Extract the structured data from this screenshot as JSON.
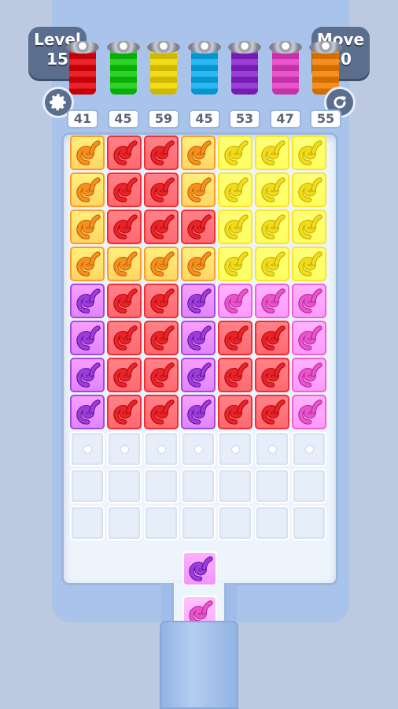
{
  "hud": {
    "level_label": "Level",
    "level_value": "15",
    "move_label": "Move",
    "move_value": "30"
  },
  "buttons": {
    "settings_icon": "gear-icon",
    "restart_icon": "restart-icon"
  },
  "colors": {
    "orange": "#f5901e",
    "red": "#e8232a",
    "yellow": "#f2dc1a",
    "purple": "#9a3fd6",
    "pink": "#e854c9",
    "green": "#2ed12a",
    "blue": "#2bb7f0"
  },
  "spools": [
    {
      "color": "red",
      "count": "41"
    },
    {
      "color": "green",
      "count": "45"
    },
    {
      "color": "yellow",
      "count": "59"
    },
    {
      "color": "blue",
      "count": "45"
    },
    {
      "color": "purple",
      "count": "53"
    },
    {
      "color": "pink",
      "count": "47"
    },
    {
      "color": "orange",
      "count": "55"
    }
  ],
  "grid": [
    [
      "orange",
      "red",
      "red",
      "orange",
      "yellow",
      "yellow",
      "yellow"
    ],
    [
      "orange",
      "red",
      "red",
      "orange",
      "yellow",
      "yellow",
      "yellow"
    ],
    [
      "orange",
      "red",
      "red",
      "red",
      "yellow",
      "yellow",
      "yellow"
    ],
    [
      "orange",
      "orange",
      "orange",
      "orange",
      "yellow",
      "yellow",
      "yellow"
    ],
    [
      "purple",
      "red",
      "red",
      "purple",
      "pink",
      "pink",
      "pink"
    ],
    [
      "purple",
      "red",
      "red",
      "purple",
      "red",
      "red",
      "pink"
    ],
    [
      "purple",
      "red",
      "red",
      "purple",
      "red",
      "red",
      "pink"
    ],
    [
      "purple",
      "red",
      "red",
      "purple",
      "red",
      "red",
      "pink"
    ],
    [
      "dot",
      "dot",
      "dot",
      "dot",
      "dot",
      "dot",
      "dot"
    ],
    [
      "empty",
      "empty",
      "empty",
      "empty",
      "empty",
      "empty",
      "empty"
    ],
    [
      "empty",
      "empty",
      "empty",
      "empty",
      "empty",
      "empty",
      "empty"
    ]
  ],
  "queue": [
    "purple",
    "pink"
  ]
}
